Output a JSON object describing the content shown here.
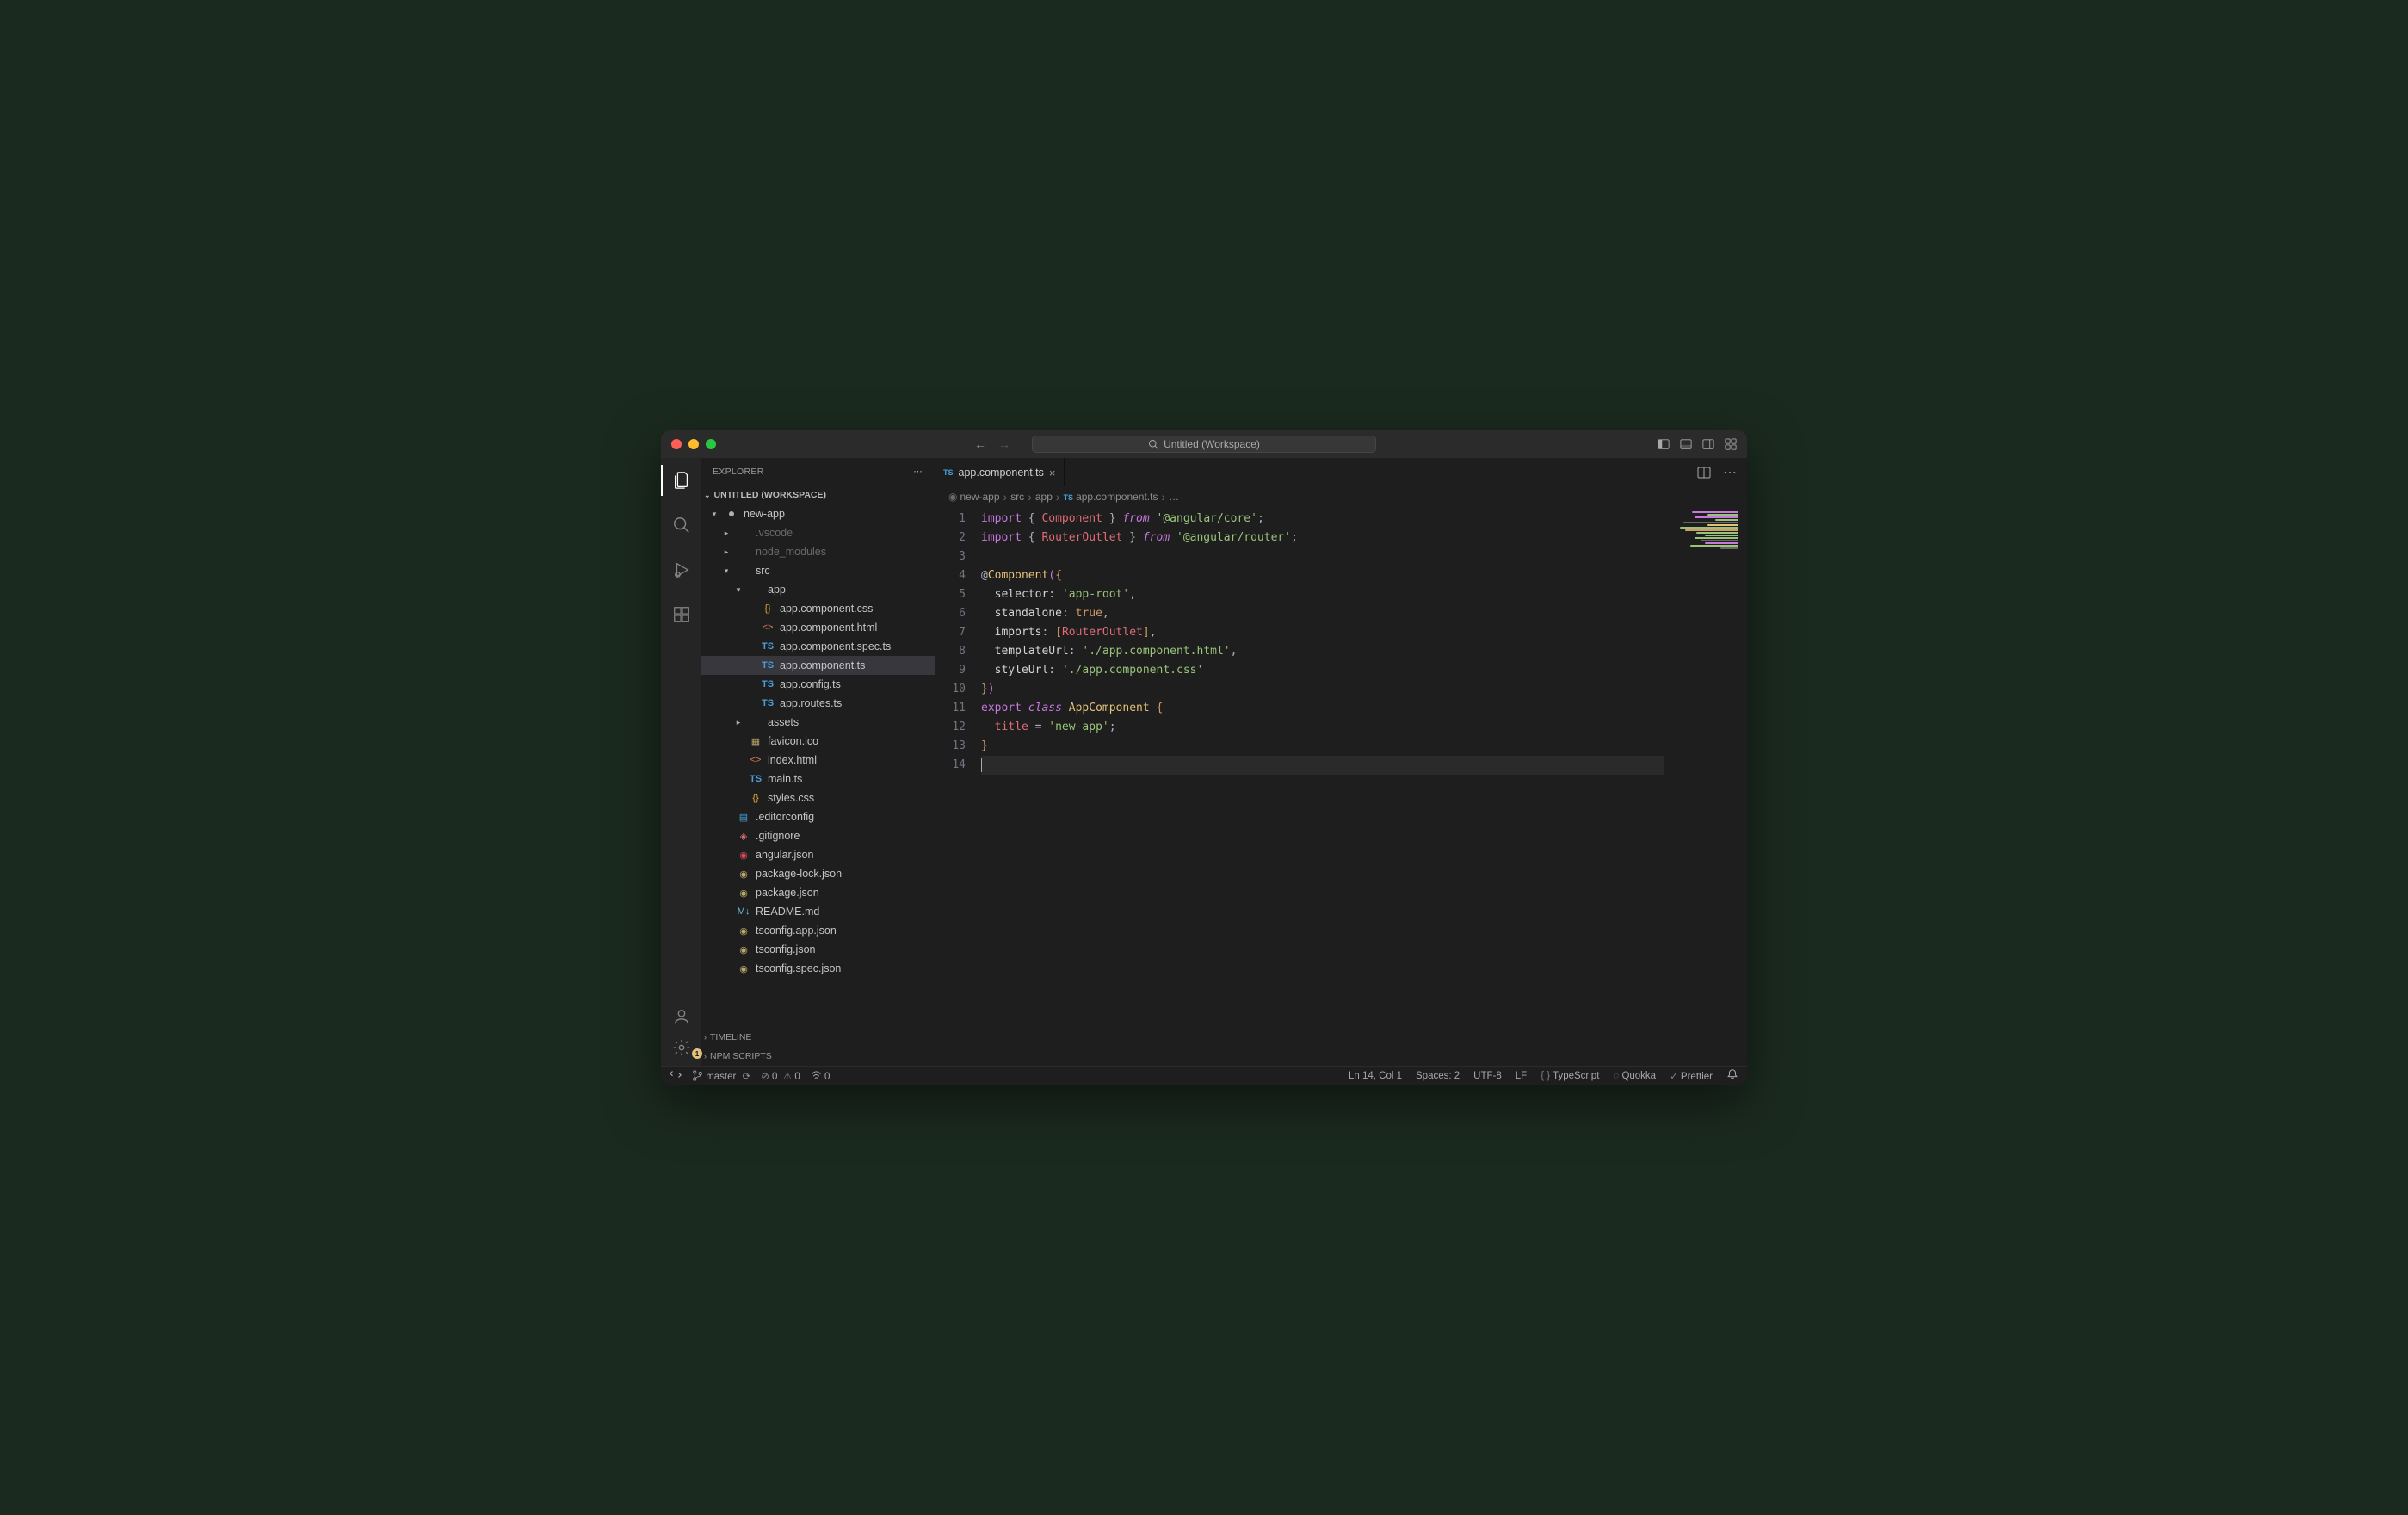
{
  "window": {
    "title": "Untitled (Workspace)"
  },
  "sidebar": {
    "header": "EXPLORER",
    "workspace_label": "UNTITLED (WORKSPACE)",
    "tree": [
      {
        "label": "new-app",
        "icon": "dot",
        "depth": 0,
        "chev": "down",
        "active": false
      },
      {
        "label": ".vscode",
        "icon": "",
        "depth": 1,
        "chev": "right",
        "muted": true
      },
      {
        "label": "node_modules",
        "icon": "",
        "depth": 1,
        "chev": "right",
        "muted": true
      },
      {
        "label": "src",
        "icon": "",
        "depth": 1,
        "chev": "down"
      },
      {
        "label": "app",
        "icon": "",
        "depth": 2,
        "chev": "down"
      },
      {
        "label": "app.component.css",
        "icon": "css",
        "depth": 3
      },
      {
        "label": "app.component.html",
        "icon": "html",
        "depth": 3
      },
      {
        "label": "app.component.spec.ts",
        "icon": "ts",
        "depth": 3
      },
      {
        "label": "app.component.ts",
        "icon": "ts",
        "depth": 3,
        "selected": true
      },
      {
        "label": "app.config.ts",
        "icon": "ts",
        "depth": 3
      },
      {
        "label": "app.routes.ts",
        "icon": "ts",
        "depth": 3
      },
      {
        "label": "assets",
        "icon": "",
        "depth": 2,
        "chev": "right"
      },
      {
        "label": "favicon.ico",
        "icon": "fav",
        "depth": 2
      },
      {
        "label": "index.html",
        "icon": "html",
        "depth": 2
      },
      {
        "label": "main.ts",
        "icon": "ts",
        "depth": 2
      },
      {
        "label": "styles.css",
        "icon": "css",
        "depth": 2
      },
      {
        "label": ".editorconfig",
        "icon": "ed",
        "depth": 1
      },
      {
        "label": ".gitignore",
        "icon": "git",
        "depth": 1
      },
      {
        "label": "angular.json",
        "icon": "ng",
        "depth": 1
      },
      {
        "label": "package-lock.json",
        "icon": "json",
        "depth": 1
      },
      {
        "label": "package.json",
        "icon": "json",
        "depth": 1
      },
      {
        "label": "README.md",
        "icon": "md",
        "depth": 1
      },
      {
        "label": "tsconfig.app.json",
        "icon": "json",
        "depth": 1
      },
      {
        "label": "tsconfig.json",
        "icon": "json",
        "depth": 1
      },
      {
        "label": "tsconfig.spec.json",
        "icon": "json",
        "depth": 1
      }
    ],
    "sections": {
      "timeline": "TIMELINE",
      "npm": "NPM SCRIPTS"
    }
  },
  "tabs": {
    "active": "app.component.ts"
  },
  "breadcrumbs": [
    "new-app",
    "src",
    "app",
    "app.component.ts",
    "…"
  ],
  "code": {
    "lines": 14,
    "content": [
      [
        [
          "kw",
          "import"
        ],
        [
          "punc",
          " { "
        ],
        [
          "id",
          "Component"
        ],
        [
          "punc",
          " } "
        ],
        [
          "ctrl",
          "from"
        ],
        [
          "punc",
          " "
        ],
        [
          "str",
          "'@angular/core'"
        ],
        [
          "punc",
          ";"
        ]
      ],
      [
        [
          "kw",
          "import"
        ],
        [
          "punc",
          " { "
        ],
        [
          "id",
          "RouterOutlet"
        ],
        [
          "punc",
          " } "
        ],
        [
          "ctrl",
          "from"
        ],
        [
          "punc",
          " "
        ],
        [
          "str",
          "'@angular/router'"
        ],
        [
          "punc",
          ";"
        ]
      ],
      [],
      [
        [
          "punc",
          "@"
        ],
        [
          "dec",
          "Component"
        ],
        [
          "brace2",
          "("
        ],
        [
          "brace",
          "{"
        ]
      ],
      [
        [
          "punc",
          "  "
        ],
        [
          "prop",
          "selector"
        ],
        [
          "punc",
          ": "
        ],
        [
          "str",
          "'app-root'"
        ],
        [
          "punc",
          ","
        ]
      ],
      [
        [
          "punc",
          "  "
        ],
        [
          "prop",
          "standalone"
        ],
        [
          "punc",
          ": "
        ],
        [
          "bool",
          "true"
        ],
        [
          "punc",
          ","
        ]
      ],
      [
        [
          "punc",
          "  "
        ],
        [
          "prop",
          "imports"
        ],
        [
          "punc",
          ": "
        ],
        [
          "brace",
          "["
        ],
        [
          "id",
          "RouterOutlet"
        ],
        [
          "brace",
          "]"
        ],
        [
          "punc",
          ","
        ]
      ],
      [
        [
          "punc",
          "  "
        ],
        [
          "prop",
          "templateUrl"
        ],
        [
          "punc",
          ": "
        ],
        [
          "str",
          "'./app.component.html'"
        ],
        [
          "punc",
          ","
        ]
      ],
      [
        [
          "punc",
          "  "
        ],
        [
          "prop",
          "styleUrl"
        ],
        [
          "punc",
          ": "
        ],
        [
          "str",
          "'./app.component.css'"
        ]
      ],
      [
        [
          "brace",
          "}"
        ],
        [
          "brace2",
          ")"
        ]
      ],
      [
        [
          "kw",
          "export"
        ],
        [
          "punc",
          " "
        ],
        [
          "ctrl",
          "class"
        ],
        [
          "punc",
          " "
        ],
        [
          "cls",
          "AppComponent"
        ],
        [
          "punc",
          " "
        ],
        [
          "brace",
          "{"
        ]
      ],
      [
        [
          "punc",
          "  "
        ],
        [
          "id",
          "title"
        ],
        [
          "punc",
          " = "
        ],
        [
          "str",
          "'new-app'"
        ],
        [
          "punc",
          ";"
        ]
      ],
      [
        [
          "brace",
          "}"
        ]
      ],
      []
    ]
  },
  "statusbar": {
    "branch": "master",
    "errors": "0",
    "warnings": "0",
    "radio": "0",
    "lncol": "Ln 14, Col 1",
    "spaces": "Spaces: 2",
    "encoding": "UTF-8",
    "eol": "LF",
    "lang": "TypeScript",
    "quokka": "Quokka",
    "prettier": "Prettier"
  },
  "settings_badge": "1"
}
